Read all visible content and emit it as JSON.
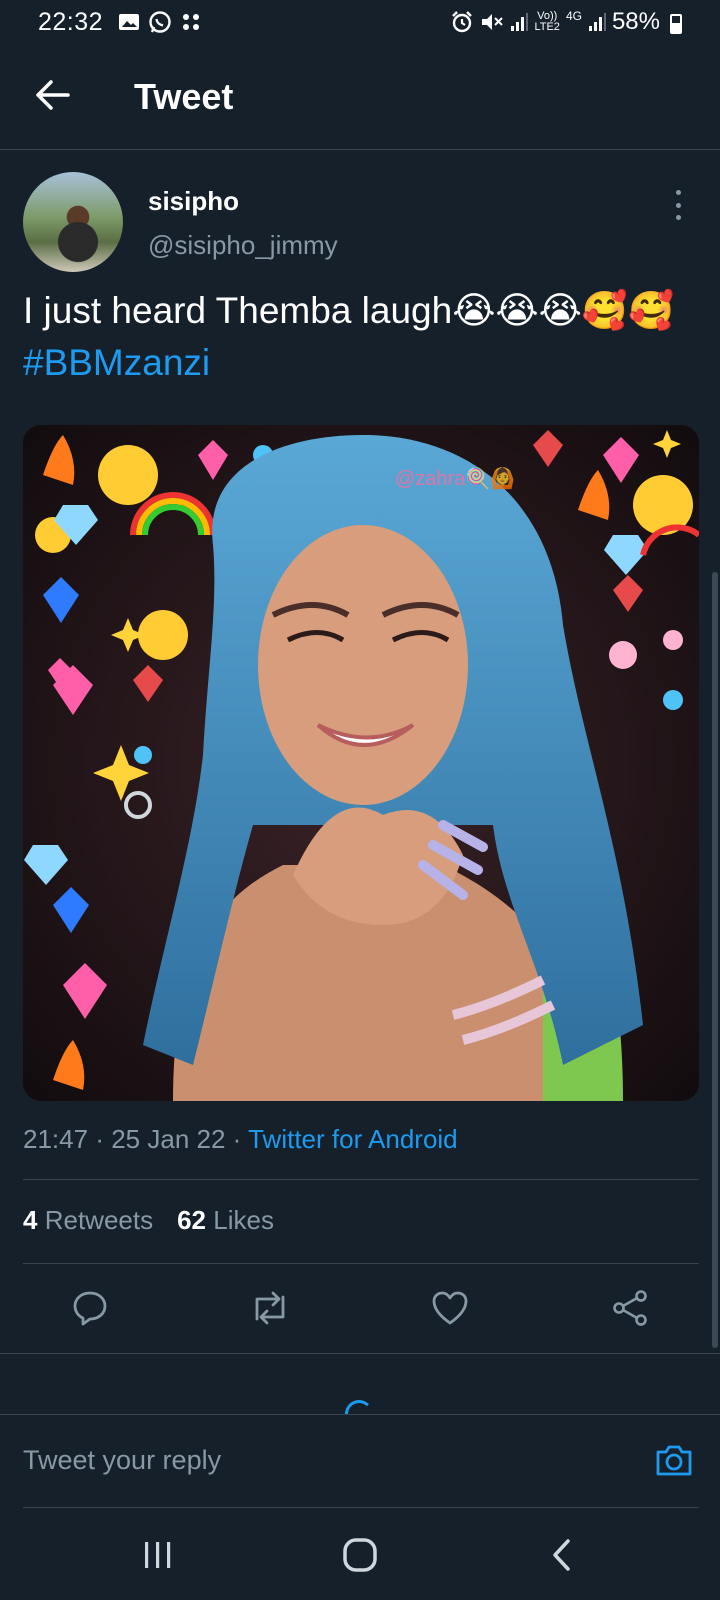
{
  "status_bar": {
    "time": "22:32",
    "battery_percent": "58%",
    "network_label": "4G",
    "lte_label": "LTE2",
    "volte_label": "Vo))"
  },
  "header": {
    "title": "Tweet",
    "back_icon": "arrow-left-icon"
  },
  "tweet": {
    "display_name": "sisipho",
    "handle": "@sisipho_jimmy",
    "text": "I just heard Themba laugh😭😭😭🥰🥰",
    "hashtag": "#BBMzanzi",
    "media_watermark": "@zahra🍭🙆",
    "time": "21:47",
    "date": "25 Jan 22",
    "source": "Twitter for Android",
    "separator": "·",
    "retweets_count": "4",
    "retweets_label": "Retweets",
    "likes_count": "62",
    "likes_label": "Likes"
  },
  "actions": {
    "reply_icon": "speech-bubble-icon",
    "retweet_icon": "retweet-icon",
    "like_icon": "heart-icon",
    "share_icon": "share-icon"
  },
  "reply_bar": {
    "placeholder": "Tweet your reply",
    "camera_icon": "camera-icon"
  },
  "colors": {
    "background": "#15202b",
    "accent": "#1d9bf0",
    "secondary_text": "#8899a6",
    "divider": "#38444d"
  }
}
